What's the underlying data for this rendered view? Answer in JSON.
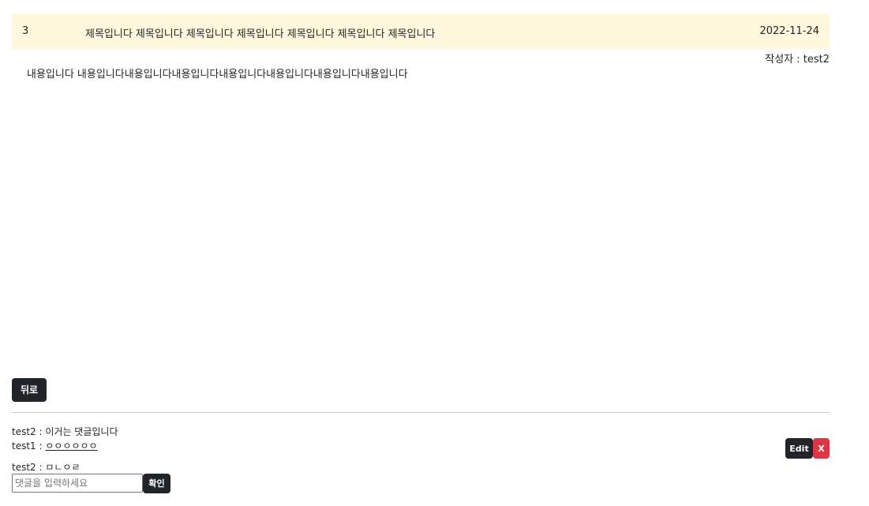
{
  "post": {
    "number": "3",
    "title": "제목입니다 제목입니다 제목입니다 제목입니다 제목입니다 제목입니다 제목입니다",
    "date": "2022-11-24",
    "author_label": "작성자 : test2",
    "body": "내용입니다 내용입니다내용입니다내용입니다내용입니다내용입니다내용입니다내용입니다"
  },
  "actions": {
    "back_label": "뒤로"
  },
  "comments": [
    {
      "author": "test2",
      "separator": " : ",
      "text": "이거는 댓글입니다"
    },
    {
      "author": "test1",
      "separator": " : ",
      "text": "ㅇㅇㅇㅇㅇㅇ"
    },
    {
      "author": "test2",
      "separator": " : ",
      "text": "ㅁㄴㅇㄹ"
    }
  ],
  "comment_actions": {
    "edit_label": "Edit",
    "delete_label": "X"
  },
  "comment_form": {
    "placeholder": "댓글을 입력하세요",
    "value": "",
    "submit_label": "확인"
  },
  "colors": {
    "header_bg": "#fff8dc",
    "dark_button": "#212529",
    "danger_button": "#dc3545"
  }
}
